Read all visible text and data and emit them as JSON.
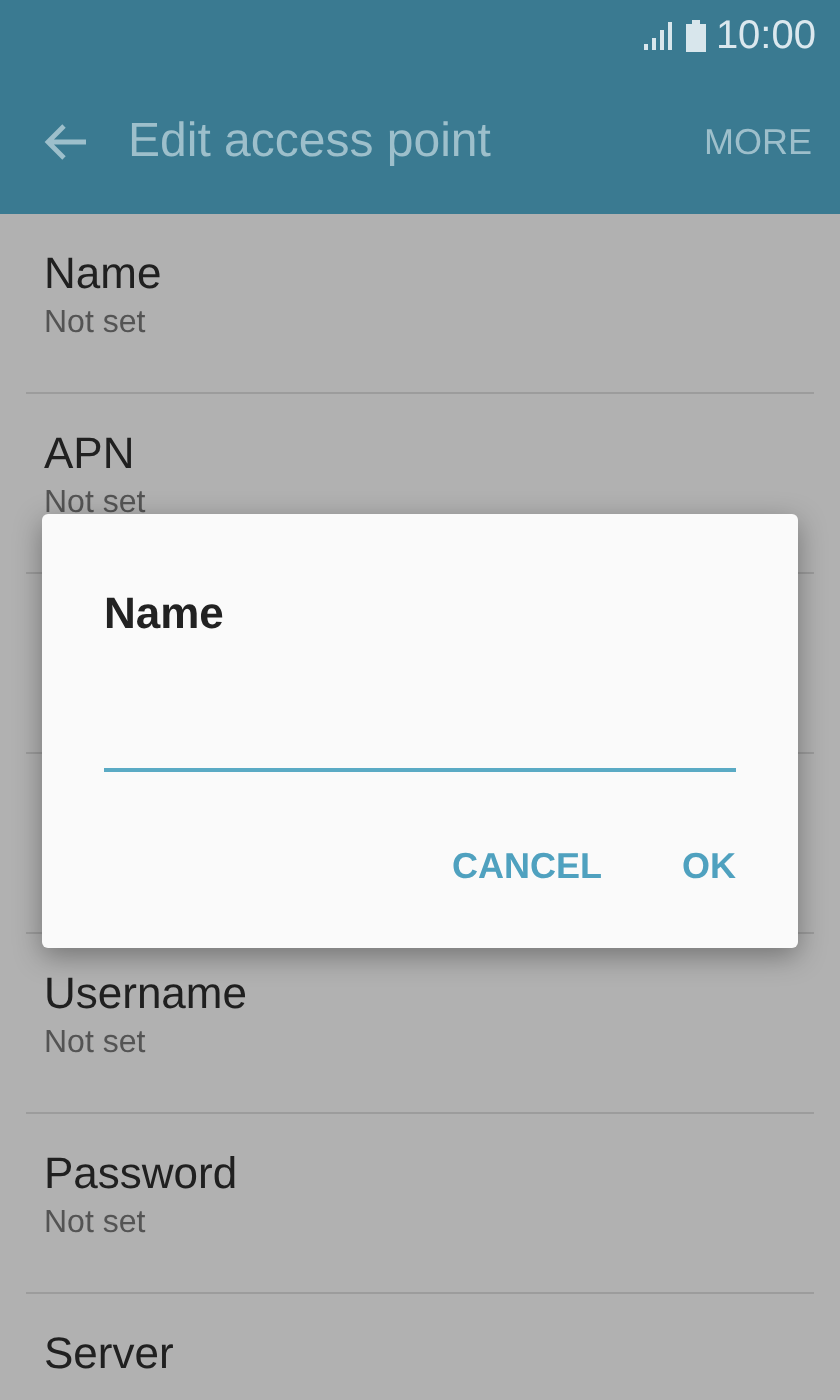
{
  "status_bar": {
    "time": "10:00"
  },
  "app_bar": {
    "title": "Edit access point",
    "action": "MORE"
  },
  "settings": [
    {
      "label": "Name",
      "value": "Not set"
    },
    {
      "label": "APN",
      "value": "Not set"
    },
    {
      "label": "Username",
      "value": "Not set"
    },
    {
      "label": "Password",
      "value": "Not set"
    },
    {
      "label": "Server"
    }
  ],
  "dialog": {
    "title": "Name",
    "buttons": [
      "CANCEL",
      "OK"
    ]
  }
}
